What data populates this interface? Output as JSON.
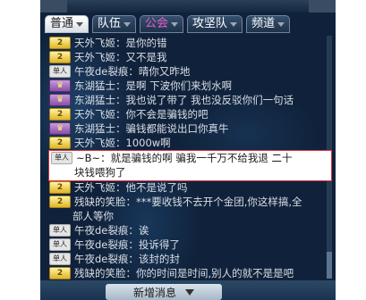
{
  "tabs": [
    {
      "label": "普通",
      "color": "#1a1a1a",
      "active": true
    },
    {
      "label": "队伍",
      "color": "#ffffff",
      "active": false
    },
    {
      "label": "公会",
      "color": "#f05ad0",
      "active": false
    },
    {
      "label": "攻坚队",
      "color": "#ffffff",
      "active": false
    },
    {
      "label": "频道",
      "color": "#ffffff",
      "active": false
    }
  ],
  "messages": [
    {
      "badge": "2",
      "type": "gold",
      "text": "天外飞姬：是你的错"
    },
    {
      "badge": "2",
      "type": "gold",
      "text": "天外飞姬：又不是我"
    },
    {
      "badge": "单人",
      "type": "single",
      "text": "午夜de裂痕：晴你又昨地"
    },
    {
      "badge": "♛",
      "type": "crown",
      "text": "东湖猛士：是啊 下波你们来划水啊"
    },
    {
      "badge": "♛",
      "type": "crown",
      "text": "东湖猛士：我也说了带了 我也没反驳你们一句话"
    },
    {
      "badge": "2",
      "type": "gold",
      "text": "天外飞姬：你不会是骗钱的吧"
    },
    {
      "badge": "♛",
      "type": "crown",
      "text": "东湖猛士：骗钱都能说出口你真牛"
    },
    {
      "badge": "2",
      "type": "gold",
      "text": "天外飞姬：1000w啊"
    }
  ],
  "highlighted_message": {
    "badge": "单人",
    "line1": "~B~：就是骗钱的啊   骗我一千万不给我退 二十",
    "line2": "块钱喂狗了"
  },
  "messages_after": [
    {
      "badge": "2",
      "type": "gold",
      "text": "天外飞姬：他不是说了吗",
      "cont": false
    },
    {
      "badge": "2",
      "type": "gold",
      "text": "残缺的笑脸：***要收钱不去开个金团,你这样搞,全",
      "cont": false
    },
    {
      "badge": "",
      "type": "",
      "text": "部人等你",
      "cont": true
    },
    {
      "badge": "单人",
      "type": "single",
      "text": "午夜de裂痕：诶",
      "cont": false
    },
    {
      "badge": "单人",
      "type": "single",
      "text": "午夜de裂痕：投诉得了",
      "cont": false
    },
    {
      "badge": "单人",
      "type": "single",
      "text": "午夜de裂痕：该封的封",
      "cont": false
    },
    {
      "badge": "2",
      "type": "gold",
      "text": "残缺的笑脸：你的时间是时间,别人的就不是是吧",
      "cont": false
    }
  ],
  "new_message_button": {
    "label": "新增消息"
  }
}
